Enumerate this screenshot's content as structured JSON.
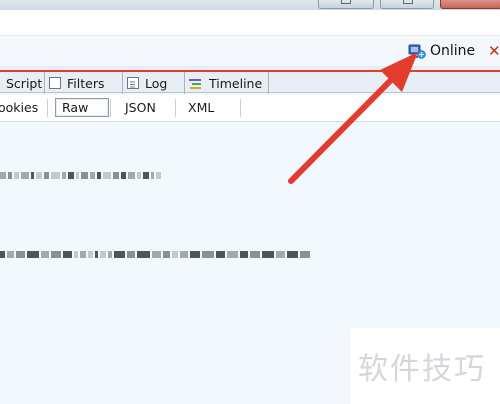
{
  "status": {
    "label": "Online",
    "close_glyph": "✕"
  },
  "tabs": [
    {
      "label": "Script",
      "icon": "script-icon"
    },
    {
      "label": "Filters",
      "icon": "filters-icon"
    },
    {
      "label": "Log",
      "icon": "log-icon"
    },
    {
      "label": "Timeline",
      "icon": "timeline-icon"
    }
  ],
  "subtabs": [
    {
      "label": "ookies"
    },
    {
      "label": "Raw"
    },
    {
      "label": "JSON"
    },
    {
      "label": "XML"
    }
  ],
  "watermark": {
    "text": "软件技巧"
  },
  "colors": {
    "annotation_red": "#e23c2f",
    "background": "#f2f8fd",
    "close_red": "#cc2a1c"
  }
}
